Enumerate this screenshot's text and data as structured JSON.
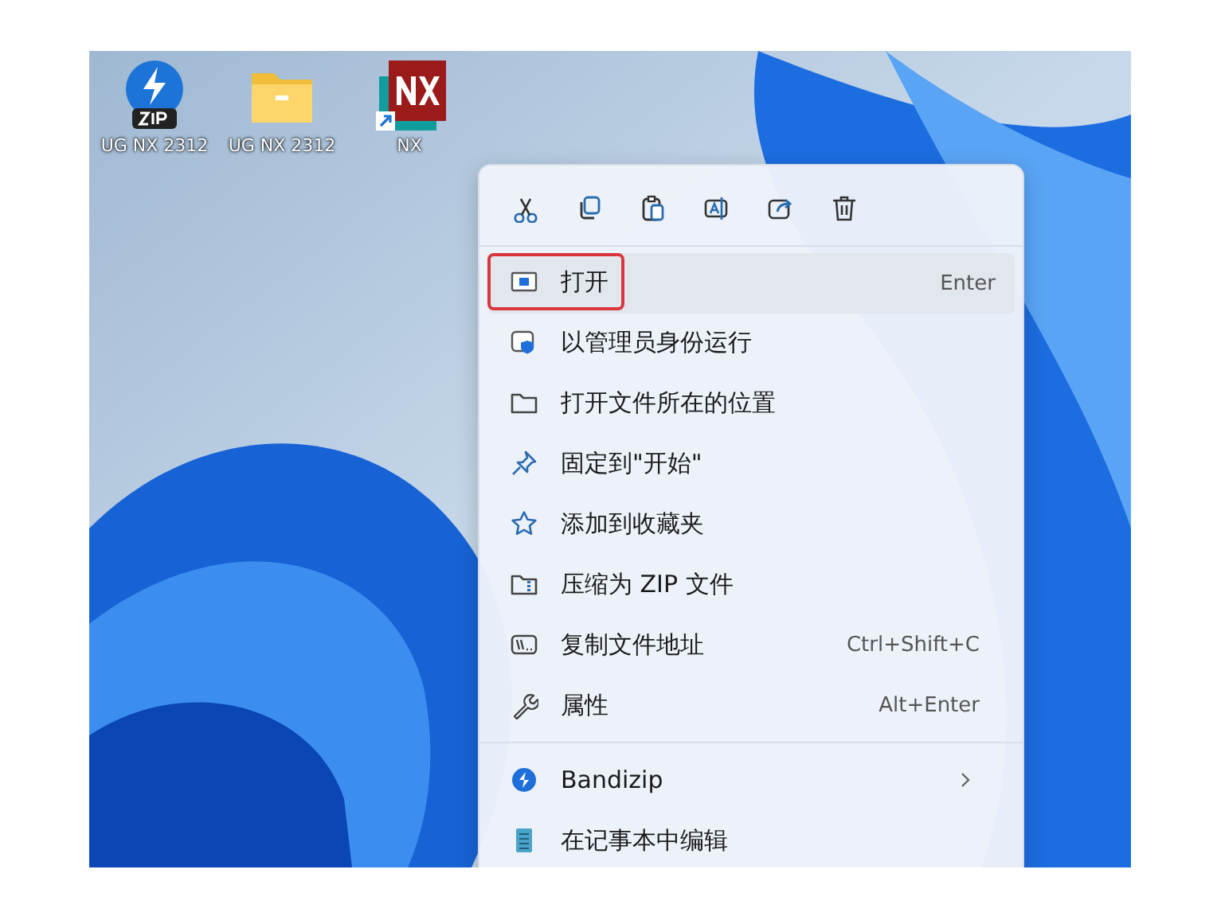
{
  "desktop_icons": [
    {
      "label": "UG NX 2312",
      "kind": "zip"
    },
    {
      "label": "UG NX 2312",
      "kind": "folder"
    },
    {
      "label": "NX",
      "kind": "nx-shortcut"
    }
  ],
  "context_menu": {
    "toolbar": [
      {
        "kind": "cut"
      },
      {
        "kind": "copy"
      },
      {
        "kind": "paste"
      },
      {
        "kind": "rename"
      },
      {
        "kind": "share"
      },
      {
        "kind": "delete"
      }
    ],
    "sections": [
      {
        "items": [
          {
            "kind": "open",
            "label": "打开",
            "shortcut": "Enter",
            "selected": true,
            "outlined": true
          },
          {
            "kind": "admin",
            "label": "以管理员身份运行",
            "selected": false,
            "outlined": false
          },
          {
            "kind": "folder",
            "label": "打开文件所在的位置",
            "selected": false,
            "outlined": false
          },
          {
            "kind": "pin",
            "label": "固定到\"开始\"",
            "selected": false,
            "outlined": false
          },
          {
            "kind": "star",
            "label": "添加到收藏夹",
            "selected": false,
            "outlined": false
          },
          {
            "kind": "zip",
            "label": "压缩为 ZIP 文件",
            "selected": false,
            "outlined": false
          },
          {
            "kind": "path",
            "label": "复制文件地址",
            "shortcut": "Ctrl+Shift+C",
            "selected": false,
            "outlined": false
          },
          {
            "kind": "wrench",
            "label": "属性",
            "shortcut": "Alt+Enter",
            "selected": false,
            "outlined": false
          }
        ]
      },
      {
        "items": [
          {
            "kind": "bandizip",
            "label": "Bandizip",
            "submenu": true,
            "selected": false,
            "outlined": false
          },
          {
            "kind": "notepad",
            "label": "在记事本中编辑",
            "selected": false,
            "outlined": false
          }
        ]
      }
    ]
  }
}
